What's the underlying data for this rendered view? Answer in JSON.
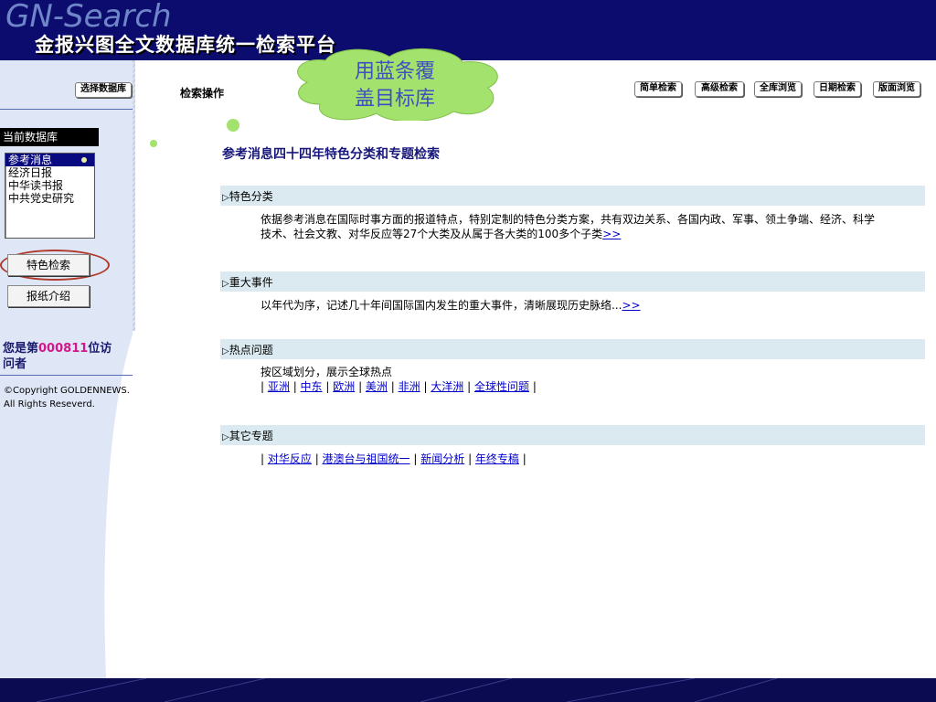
{
  "header": {
    "brand": "GN-Search",
    "title": "金报兴图全文数据库统一检索平台"
  },
  "sidebar": {
    "select_db_label": "选择数据库",
    "current_db_heading": "当前数据库",
    "databases": [
      "参考消息",
      "经济日报",
      "中华读书报",
      "中共党史研究"
    ],
    "selected_database": "参考消息",
    "feature_search_label": "特色检索",
    "newspaper_intro_label": "报纸介绍",
    "visitor_prefix": "您是第",
    "visitor_count": "000811",
    "visitor_suffix": "位访问者",
    "copyright_line1": "©Copyright GOLDENNEWS.",
    "copyright_line2": "All Rights Reseverd."
  },
  "toolbar": {
    "section_title": "检索操作",
    "tabs": [
      "简单检索",
      "高级检索",
      "全库浏览",
      "日期检索",
      "版面浏览"
    ]
  },
  "callout": {
    "line1": "用蓝条覆",
    "line2": "盖目标库"
  },
  "main": {
    "title": "参考消息四十四年特色分类和专题检索",
    "sections": [
      {
        "heading": "特色分类",
        "text_line1": "依据参考消息在国际时事方面的报道特点，特别定制的特色分类方案，共有双边关系、各国内政、军事、领土争端、经济、科学",
        "text_line2": "技术、社会文教、对华反应等27个大类及从属于各大类的100多个子类",
        "more_link": ">>"
      },
      {
        "heading": "重大事件",
        "text_line1": "以年代为序，记述几十年间国际国内发生的重大事件，清晰展现历史脉络...",
        "more_link": ">>"
      },
      {
        "heading": "热点问题",
        "text_line1": "按区域划分，展示全球热点",
        "links": [
          "亚洲",
          "中东",
          "欧洲",
          "美洲",
          "非洲",
          "大洋洲",
          "全球性问题"
        ]
      },
      {
        "heading": "其它专题",
        "links": [
          "对华反应",
          "港澳台与祖国统一",
          "新闻分析",
          "年终专稿"
        ]
      }
    ]
  },
  "colors": {
    "header_bg": "#0c0c6e",
    "selected_bg": "#0a0a80",
    "visitor_number": "#d0188a",
    "section_bar": "#dbeaf0",
    "link": "#0000cc",
    "callout_cloud": "#a3e26c"
  }
}
